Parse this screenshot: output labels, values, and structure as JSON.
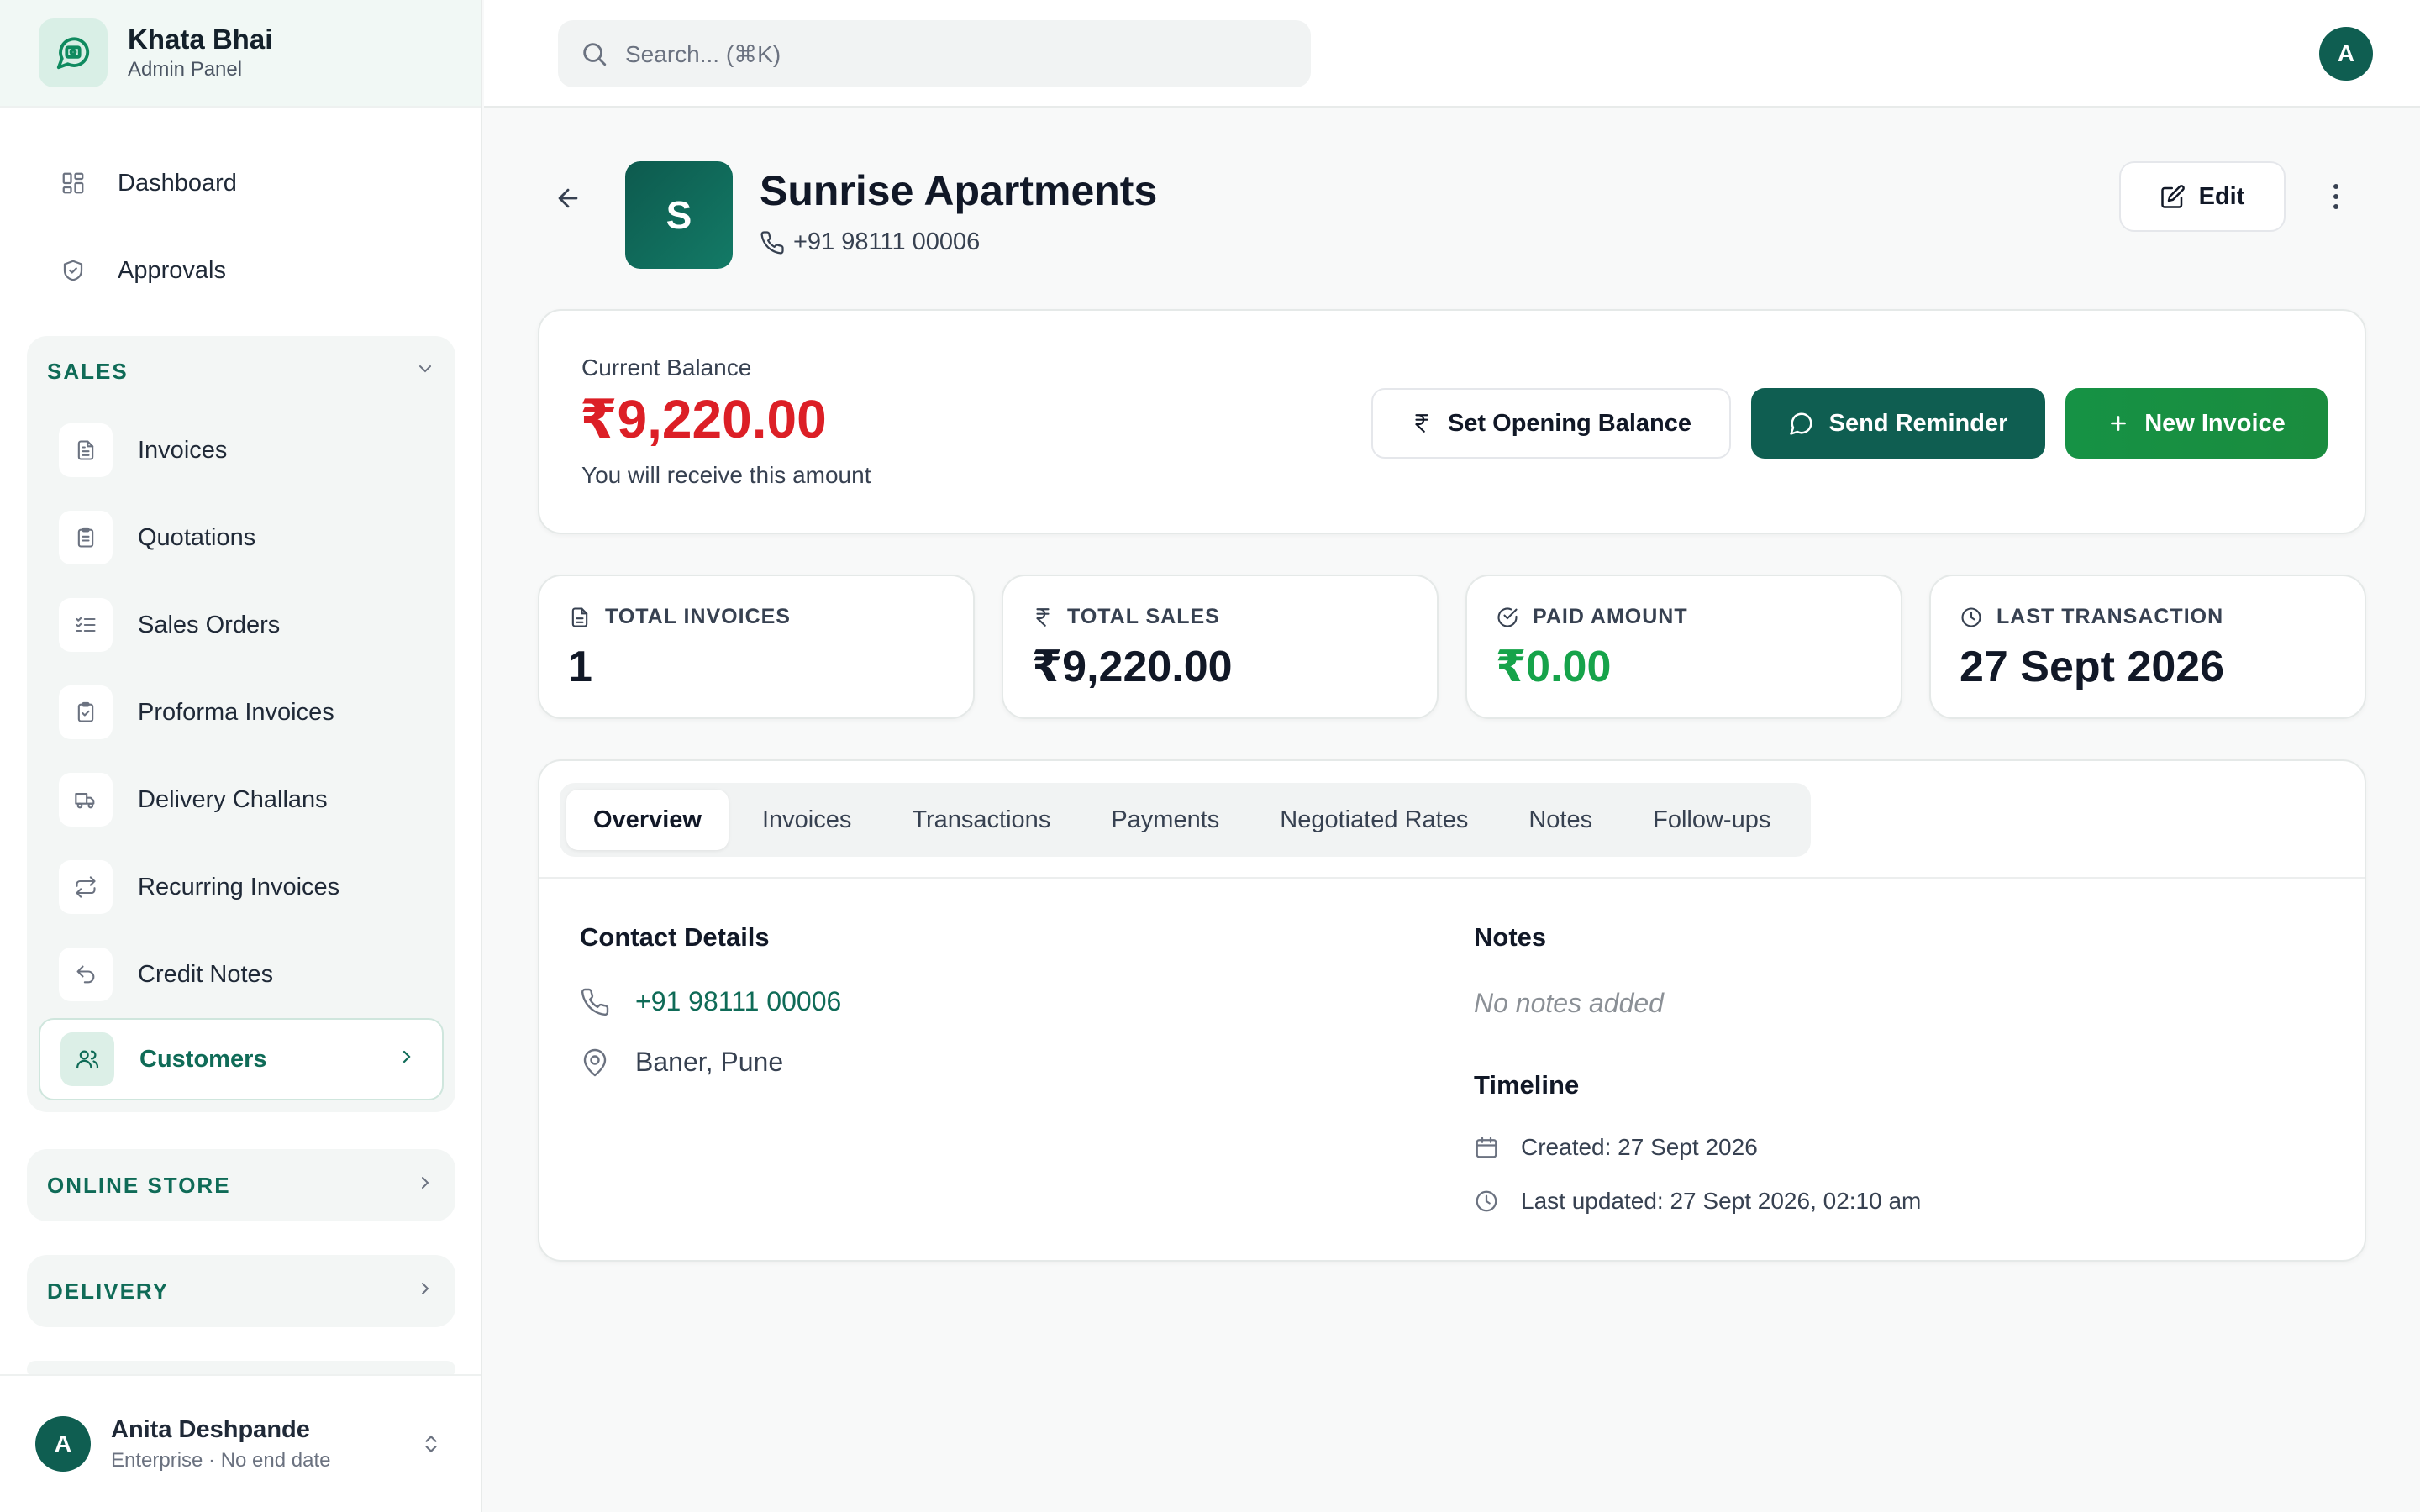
{
  "brand": {
    "title": "Khata Bhai",
    "subtitle": "Admin Panel"
  },
  "nav": {
    "dashboard": "Dashboard",
    "approvals": "Approvals"
  },
  "sales": {
    "heading": "SALES",
    "items": [
      {
        "label": "Invoices",
        "icon": "file-text-icon"
      },
      {
        "label": "Quotations",
        "icon": "clipboard-icon"
      },
      {
        "label": "Sales Orders",
        "icon": "list-check-icon"
      },
      {
        "label": "Proforma Invoices",
        "icon": "clipboard-check-icon"
      },
      {
        "label": "Delivery Challans",
        "icon": "truck-icon"
      },
      {
        "label": "Recurring Invoices",
        "icon": "repeat-icon"
      },
      {
        "label": "Credit Notes",
        "icon": "undo-icon"
      },
      {
        "label": "Customers",
        "icon": "users-icon"
      }
    ]
  },
  "sections": {
    "online_store": "ONLINE STORE",
    "delivery": "DELIVERY"
  },
  "user": {
    "initial": "A",
    "name": "Anita Deshpande",
    "plan": "Enterprise · No end date"
  },
  "topbar": {
    "search_placeholder": "Search... (⌘K)",
    "avatar_initial": "A"
  },
  "customer": {
    "initial": "S",
    "name": "Sunrise Apartments",
    "phone": "+91 98111 00006",
    "edit_label": "Edit"
  },
  "balance": {
    "label": "Current Balance",
    "amount": "₹9,220.00",
    "note": "You will receive this amount",
    "set_opening_label": "Set Opening Balance",
    "send_reminder_label": "Send Reminder",
    "new_invoice_label": "New Invoice"
  },
  "stats": [
    {
      "label": "TOTAL INVOICES",
      "value": "1"
    },
    {
      "label": "TOTAL SALES",
      "value": "₹9,220.00"
    },
    {
      "label": "PAID AMOUNT",
      "value": "₹0.00"
    },
    {
      "label": "LAST TRANSACTION",
      "value": "27 Sept 2026"
    }
  ],
  "tabs": [
    "Overview",
    "Invoices",
    "Transactions",
    "Payments",
    "Negotiated Rates",
    "Notes",
    "Follow-ups"
  ],
  "overview": {
    "contact_heading": "Contact Details",
    "phone": "+91 98111 00006",
    "location": "Baner, Pune",
    "notes_heading": "Notes",
    "notes_empty": "No notes added",
    "timeline_heading": "Timeline",
    "created": "Created: 27 Sept 2026",
    "updated": "Last updated: 27 Sept 2026, 02:10 am"
  },
  "colors": {
    "brand_dark": "#0f5e51",
    "accent_text": "#0f6b57",
    "balance_red": "#dc1f26",
    "paid_green": "#16a34a",
    "new_invoice_green": "#169245"
  }
}
